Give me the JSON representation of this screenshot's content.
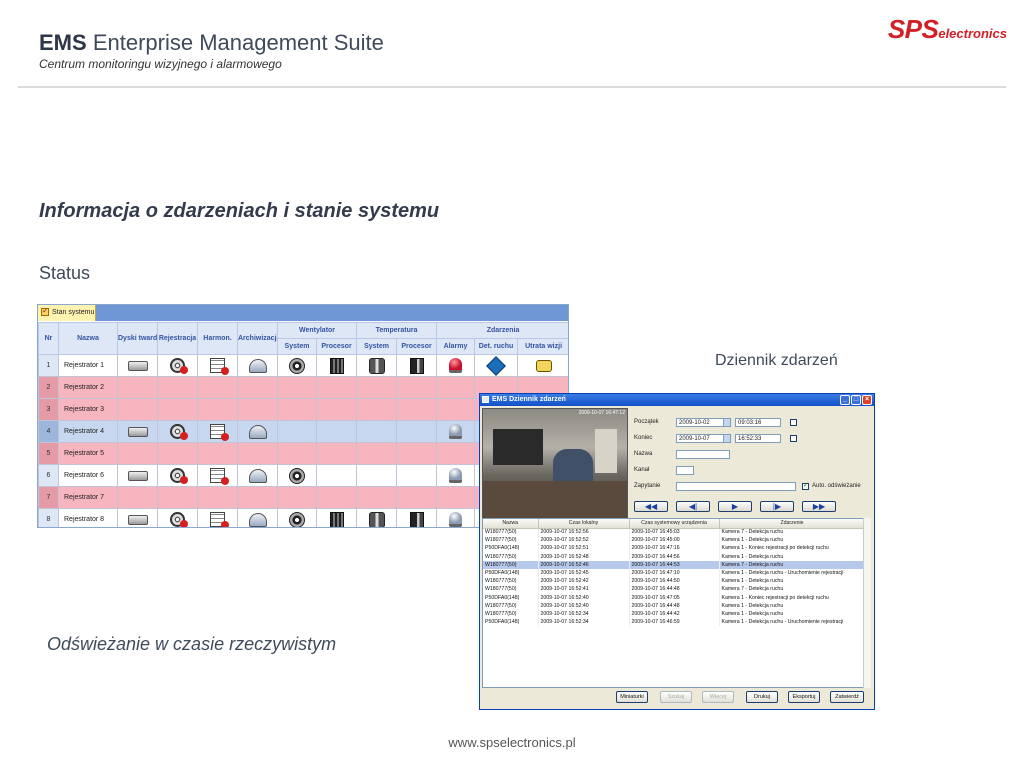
{
  "header": {
    "title_bold": "EMS",
    "title_rest": "Enterprise Management Suite",
    "subtitle": "Centrum monitoringu wizyjnego i alarmowego",
    "logo_sps": "SPS",
    "logo_electronics": "electronics",
    "logo_color": "#d41f26"
  },
  "heading": "Informacja o zdarzeniach i stanie systemu",
  "status_label": "Status",
  "diary_label": "Dziennik zdarzeń",
  "refresh_label": "Odświeżanie w czasie rzeczywistym",
  "footer": "www.spselectronics.pl",
  "status_panel": {
    "tab": "Stan systemu",
    "columns": {
      "nr": "Nr",
      "name": "Nazwa",
      "disks": "Dyski twarde",
      "recording": "Rejestracja",
      "schedule": "Harmon.",
      "archiving": "Archiwizacja",
      "fans": "Wentylator",
      "temperature": "Temperatura",
      "events": "Zdarzenia",
      "system": "System",
      "cpu": "Procesor",
      "alarms": "Alarmy",
      "motion": "Det. ruchu",
      "signal_loss": "Utrata wizji"
    },
    "rows": [
      {
        "nr": "1",
        "name": "Rejestrator 1",
        "state": "ok"
      },
      {
        "nr": "2",
        "name": "Rejestrator 2",
        "state": "err"
      },
      {
        "nr": "3",
        "name": "Rejestrator 3",
        "state": "err"
      },
      {
        "nr": "4",
        "name": "Rejestrator 4",
        "state": "sel"
      },
      {
        "nr": "5",
        "name": "Rejestrator 5",
        "state": "err"
      },
      {
        "nr": "6",
        "name": "Rejestrator 6",
        "state": "ok"
      },
      {
        "nr": "7",
        "name": "Rejestrator 7",
        "state": "err"
      },
      {
        "nr": "8",
        "name": "Rejestrator 8",
        "state": "ok"
      }
    ]
  },
  "event_window": {
    "title": "EMS Dziennik zdarzeń",
    "video_timestamp": "2009-10-07 16:47:12",
    "form": {
      "start_label": "Początek",
      "start_date": "2009-10-02",
      "start_time": "09:03:16",
      "end_label": "Koniec",
      "end_date": "2009-10-07",
      "end_time": "16:52:33",
      "name_label": "Nazwa",
      "channel_label": "Kanał",
      "query_label": "Zapytanie",
      "auto_refresh_label": "Auto. odświeżanie"
    },
    "nav_buttons": [
      "◀◀",
      "◀|",
      "▶",
      "|▶",
      "▶▶"
    ],
    "table_headers": [
      "Nazwa",
      "Czas lokalny",
      "Czas systemowy urządzenia",
      "Zdarzenie"
    ],
    "rows": [
      [
        "W180777(50)",
        "2009-10-07 16:52:56",
        "2009-10-07 16:45:03",
        "Kamera 7 - Detekcja ruchu"
      ],
      [
        "W180777(50)",
        "2009-10-07 16:52:52",
        "2009-10-07 16:45:00",
        "Kamera 1 - Detekcja ruchu"
      ],
      [
        "P50DFA0(148)",
        "2009-10-07 16:52:51",
        "2009-10-07 16:47:16",
        "Kamera 1 - Koniec rejestracji po detekcji ruchu"
      ],
      [
        "W180777(50)",
        "2009-10-07 16:52:48",
        "2009-10-07 16:44:56",
        "Kamera 1 - Detekcja ruchu"
      ],
      [
        "W180777(50)",
        "2009-10-07 16:52:46",
        "2009-10-07 16:44:53",
        "Kamera 7 - Detekcja ruchu"
      ],
      [
        "P50DFA0(148)",
        "2009-10-07 16:52:45",
        "2009-10-07 16:47:10",
        "Kamera 1 - Detekcja ruchu - Uruchomienie rejestracji"
      ],
      [
        "W180777(50)",
        "2009-10-07 16:52:42",
        "2009-10-07 16:44:50",
        "Kamera 1 - Detekcja ruchu"
      ],
      [
        "W180777(50)",
        "2009-10-07 16:52:41",
        "2009-10-07 16:44:48",
        "Kamera 7 - Detekcja ruchu"
      ],
      [
        "P50DFA0(148)",
        "2009-10-07 16:52:40",
        "2009-10-07 16:47:05",
        "Kamera 1 - Koniec rejestracji po detekcji ruchu"
      ],
      [
        "W180777(50)",
        "2009-10-07 16:52:40",
        "2009-10-07 16:44:48",
        "Kamera 1 - Detekcja ruchu"
      ],
      [
        "W180777(50)",
        "2009-10-07 16:52:34",
        "2009-10-07 16:44:42",
        "Kamera 1 - Detekcja ruchu"
      ],
      [
        "P50DFA0(148)",
        "2009-10-07 16:52:34",
        "2009-10-07 16:46:59",
        "Kamera 1 - Detekcja ruchu - Uruchomienie rejestracji"
      ]
    ],
    "highlighted_row": 4,
    "bottom_buttons": [
      {
        "label": "Miniaturki",
        "enabled": true
      },
      {
        "label": "Szukaj",
        "enabled": false
      },
      {
        "label": "Więcej",
        "enabled": false
      },
      {
        "label": "Drukuj",
        "enabled": true
      },
      {
        "label": "Eksportuj",
        "enabled": true
      },
      {
        "label": "Zatwierdź",
        "enabled": true
      }
    ]
  }
}
